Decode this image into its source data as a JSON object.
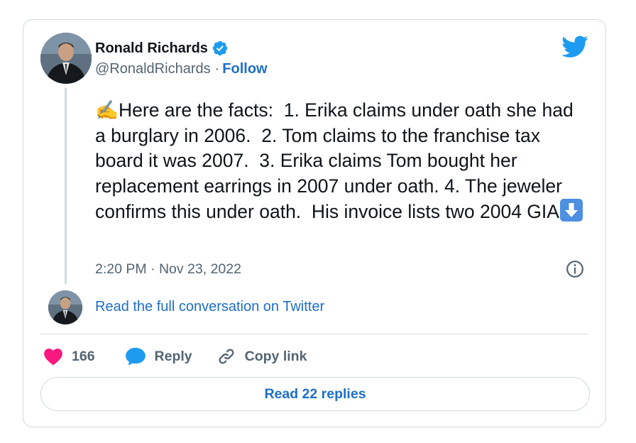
{
  "author": {
    "display_name": "Ronald Richards",
    "handle": "@RonaldRichards",
    "separator": "·",
    "follow_label": "Follow"
  },
  "tweet": {
    "emoji_start": "✍️",
    "text": "Here are the facts:  1. Erika claims under oath she had a burglary in 2006.  2. Tom claims to the franchise tax board it was 2007.  3. Erika claims Tom bought her replacement earrings in 2007 under oath. 4. The jeweler confirms this under oath.  His invoice lists two 2004 GIA",
    "emoji_end": "⬇️",
    "timestamp": "2:20 PM · Nov 23, 2022"
  },
  "conversation": {
    "link_label": "Read the full conversation on Twitter"
  },
  "actions": {
    "like_count": "166",
    "reply_label": "Reply",
    "copy_label": "Copy link"
  },
  "replies_button": {
    "label": "Read 22 replies"
  },
  "icons": {
    "verified": "verified-badge-icon",
    "brand": "twitter-bird-icon",
    "info": "info-icon",
    "like": "heart-icon",
    "reply": "speech-bubble-icon",
    "copy": "link-icon"
  },
  "colors": {
    "link": "#1d6fc7",
    "like": "#f91880",
    "reply": "#1d9bf0",
    "verified": "#1d9bf0",
    "brand": "#1d9bf0",
    "muted_text": "#536471",
    "border": "#cfd9de"
  }
}
